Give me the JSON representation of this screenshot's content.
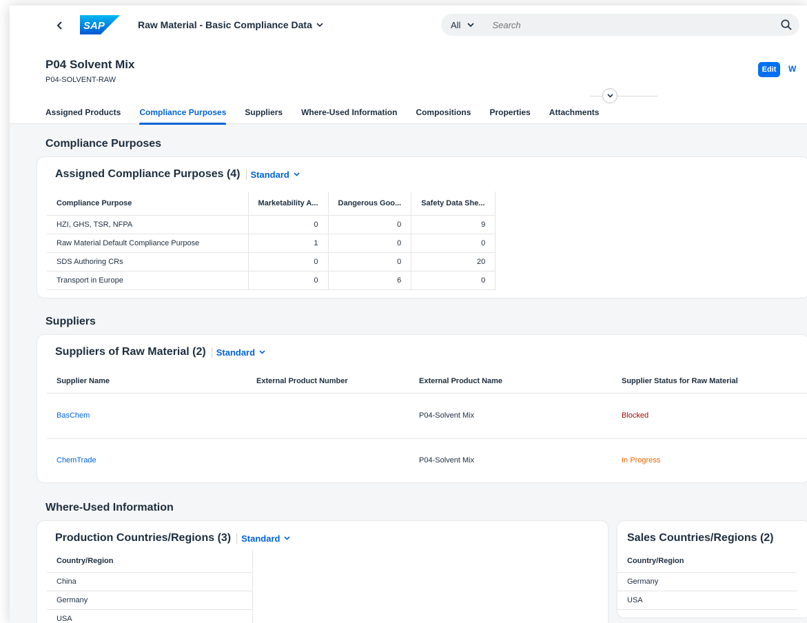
{
  "shell": {
    "back_label": "<",
    "logo_text": "SAP",
    "app_title": "Raw Material - Basic Compliance Data",
    "search_scope": "All",
    "search_placeholder": "Search"
  },
  "header": {
    "title": "P04 Solvent Mix",
    "subtitle": "P04-SOLVENT-RAW",
    "edit_label": "Edit",
    "more_label": "W"
  },
  "tabs": [
    {
      "label": "Assigned Products"
    },
    {
      "label": "Compliance Purposes",
      "active": true
    },
    {
      "label": "Suppliers"
    },
    {
      "label": "Where-Used Information"
    },
    {
      "label": "Compositions"
    },
    {
      "label": "Properties"
    },
    {
      "label": "Attachments"
    }
  ],
  "compliance": {
    "section_title": "Compliance Purposes",
    "card_title": "Assigned Compliance Purposes (4)",
    "variant": "Standard",
    "columns": [
      "Compliance Purpose",
      "Marketability A...",
      "Dangerous Goo...",
      "Safety Data She..."
    ],
    "rows": [
      [
        "HZI, GHS, TSR, NFPA",
        "0",
        "0",
        "9"
      ],
      [
        "Raw Material Default Compliance Purpose",
        "1",
        "0",
        "0"
      ],
      [
        "SDS Authoring CRs",
        "0",
        "0",
        "20"
      ],
      [
        "Transport in Europe",
        "0",
        "6",
        "0"
      ]
    ]
  },
  "suppliers": {
    "section_title": "Suppliers",
    "card_title": "Suppliers of Raw Material (2)",
    "variant": "Standard",
    "columns": [
      "Supplier Name",
      "External Product Number",
      "External Product Name",
      "Supplier Status for Raw Material"
    ],
    "rows": [
      [
        "BasChem",
        "",
        "P04-Solvent Mix",
        "Blocked"
      ],
      [
        "ChemTrade",
        "",
        "P04-Solvent Mix",
        "In Progress"
      ]
    ],
    "status_colors": {
      "Blocked": "#aa0808",
      "In Progress": "#e76500"
    }
  },
  "whereused": {
    "section_title": "Where-Used Information",
    "production": {
      "card_title": "Production Countries/Regions (3)",
      "variant": "Standard",
      "column": "Country/Region",
      "rows": [
        "China",
        "Germany",
        "USA"
      ]
    },
    "sales": {
      "card_title": "Sales Countries/Regions (2)",
      "column": "Country/Region",
      "rows": [
        "Germany",
        "USA"
      ]
    }
  },
  "colors": {
    "accent": "#0064d9",
    "button": "#0070f2",
    "brand_logo": "#0a6ed1"
  }
}
